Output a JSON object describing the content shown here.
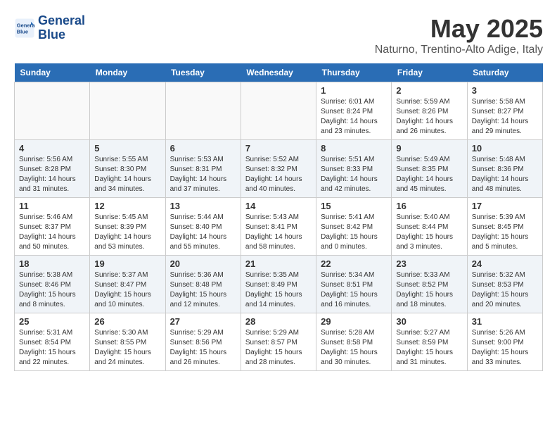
{
  "header": {
    "logo_line1": "General",
    "logo_line2": "Blue",
    "title": "May 2025",
    "subtitle": "Naturno, Trentino-Alto Adige, Italy"
  },
  "calendar": {
    "weekdays": [
      "Sunday",
      "Monday",
      "Tuesday",
      "Wednesday",
      "Thursday",
      "Friday",
      "Saturday"
    ],
    "weeks": [
      [
        {
          "day": "",
          "info": ""
        },
        {
          "day": "",
          "info": ""
        },
        {
          "day": "",
          "info": ""
        },
        {
          "day": "",
          "info": ""
        },
        {
          "day": "1",
          "info": "Sunrise: 6:01 AM\nSunset: 8:24 PM\nDaylight: 14 hours\nand 23 minutes."
        },
        {
          "day": "2",
          "info": "Sunrise: 5:59 AM\nSunset: 8:26 PM\nDaylight: 14 hours\nand 26 minutes."
        },
        {
          "day": "3",
          "info": "Sunrise: 5:58 AM\nSunset: 8:27 PM\nDaylight: 14 hours\nand 29 minutes."
        }
      ],
      [
        {
          "day": "4",
          "info": "Sunrise: 5:56 AM\nSunset: 8:28 PM\nDaylight: 14 hours\nand 31 minutes."
        },
        {
          "day": "5",
          "info": "Sunrise: 5:55 AM\nSunset: 8:30 PM\nDaylight: 14 hours\nand 34 minutes."
        },
        {
          "day": "6",
          "info": "Sunrise: 5:53 AM\nSunset: 8:31 PM\nDaylight: 14 hours\nand 37 minutes."
        },
        {
          "day": "7",
          "info": "Sunrise: 5:52 AM\nSunset: 8:32 PM\nDaylight: 14 hours\nand 40 minutes."
        },
        {
          "day": "8",
          "info": "Sunrise: 5:51 AM\nSunset: 8:33 PM\nDaylight: 14 hours\nand 42 minutes."
        },
        {
          "day": "9",
          "info": "Sunrise: 5:49 AM\nSunset: 8:35 PM\nDaylight: 14 hours\nand 45 minutes."
        },
        {
          "day": "10",
          "info": "Sunrise: 5:48 AM\nSunset: 8:36 PM\nDaylight: 14 hours\nand 48 minutes."
        }
      ],
      [
        {
          "day": "11",
          "info": "Sunrise: 5:46 AM\nSunset: 8:37 PM\nDaylight: 14 hours\nand 50 minutes."
        },
        {
          "day": "12",
          "info": "Sunrise: 5:45 AM\nSunset: 8:39 PM\nDaylight: 14 hours\nand 53 minutes."
        },
        {
          "day": "13",
          "info": "Sunrise: 5:44 AM\nSunset: 8:40 PM\nDaylight: 14 hours\nand 55 minutes."
        },
        {
          "day": "14",
          "info": "Sunrise: 5:43 AM\nSunset: 8:41 PM\nDaylight: 14 hours\nand 58 minutes."
        },
        {
          "day": "15",
          "info": "Sunrise: 5:41 AM\nSunset: 8:42 PM\nDaylight: 15 hours\nand 0 minutes."
        },
        {
          "day": "16",
          "info": "Sunrise: 5:40 AM\nSunset: 8:44 PM\nDaylight: 15 hours\nand 3 minutes."
        },
        {
          "day": "17",
          "info": "Sunrise: 5:39 AM\nSunset: 8:45 PM\nDaylight: 15 hours\nand 5 minutes."
        }
      ],
      [
        {
          "day": "18",
          "info": "Sunrise: 5:38 AM\nSunset: 8:46 PM\nDaylight: 15 hours\nand 8 minutes."
        },
        {
          "day": "19",
          "info": "Sunrise: 5:37 AM\nSunset: 8:47 PM\nDaylight: 15 hours\nand 10 minutes."
        },
        {
          "day": "20",
          "info": "Sunrise: 5:36 AM\nSunset: 8:48 PM\nDaylight: 15 hours\nand 12 minutes."
        },
        {
          "day": "21",
          "info": "Sunrise: 5:35 AM\nSunset: 8:49 PM\nDaylight: 15 hours\nand 14 minutes."
        },
        {
          "day": "22",
          "info": "Sunrise: 5:34 AM\nSunset: 8:51 PM\nDaylight: 15 hours\nand 16 minutes."
        },
        {
          "day": "23",
          "info": "Sunrise: 5:33 AM\nSunset: 8:52 PM\nDaylight: 15 hours\nand 18 minutes."
        },
        {
          "day": "24",
          "info": "Sunrise: 5:32 AM\nSunset: 8:53 PM\nDaylight: 15 hours\nand 20 minutes."
        }
      ],
      [
        {
          "day": "25",
          "info": "Sunrise: 5:31 AM\nSunset: 8:54 PM\nDaylight: 15 hours\nand 22 minutes."
        },
        {
          "day": "26",
          "info": "Sunrise: 5:30 AM\nSunset: 8:55 PM\nDaylight: 15 hours\nand 24 minutes."
        },
        {
          "day": "27",
          "info": "Sunrise: 5:29 AM\nSunset: 8:56 PM\nDaylight: 15 hours\nand 26 minutes."
        },
        {
          "day": "28",
          "info": "Sunrise: 5:29 AM\nSunset: 8:57 PM\nDaylight: 15 hours\nand 28 minutes."
        },
        {
          "day": "29",
          "info": "Sunrise: 5:28 AM\nSunset: 8:58 PM\nDaylight: 15 hours\nand 30 minutes."
        },
        {
          "day": "30",
          "info": "Sunrise: 5:27 AM\nSunset: 8:59 PM\nDaylight: 15 hours\nand 31 minutes."
        },
        {
          "day": "31",
          "info": "Sunrise: 5:26 AM\nSunset: 9:00 PM\nDaylight: 15 hours\nand 33 minutes."
        }
      ]
    ]
  }
}
